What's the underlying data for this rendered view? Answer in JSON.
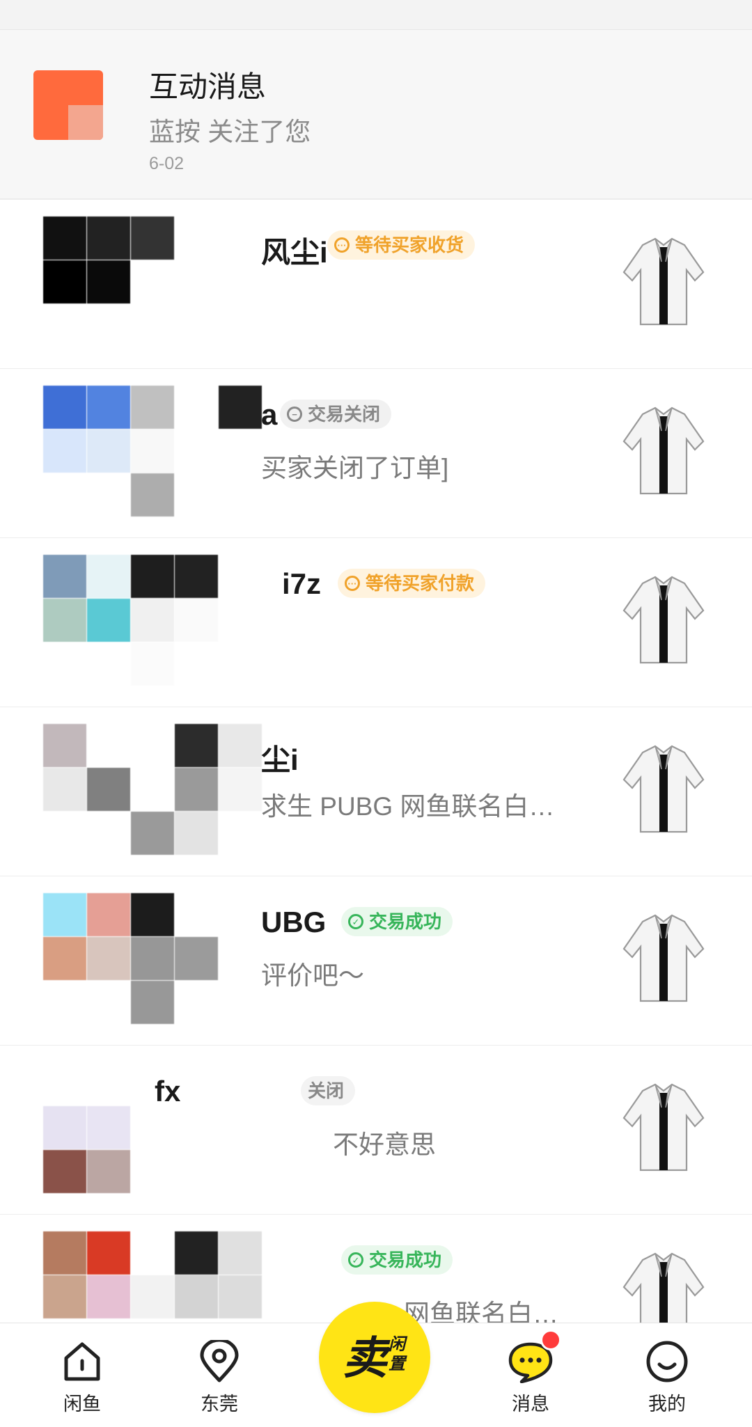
{
  "interaction": {
    "title": "互动消息",
    "message": "蓝按 关注了您",
    "time": "6-02"
  },
  "conversations": [
    {
      "name": "风尘i",
      "status": "等待买家收货",
      "status_type": "wait",
      "message": ""
    },
    {
      "name": "a",
      "status": "交易关闭",
      "status_type": "closed",
      "message": "买家关闭了订单]"
    },
    {
      "name": "i7z",
      "status": "等待买家付款",
      "status_type": "wait",
      "message": ""
    },
    {
      "name": "尘i",
      "status": "",
      "status_type": "",
      "message": "求生 PUBG 网鱼联名白…"
    },
    {
      "name": "UBG",
      "status": "交易成功",
      "status_type": "success",
      "message": "评价吧～"
    },
    {
      "name": "fx",
      "status": "关闭",
      "status_type": "closed",
      "message": "不好意思"
    },
    {
      "name": "",
      "status": "交易成功",
      "status_type": "success",
      "message": "网鱼联名白…"
    }
  ],
  "tabbar": {
    "home": "闲鱼",
    "nearby": "东莞",
    "sell_big": "卖",
    "sell_small": "闲置",
    "messages": "消息",
    "mine": "我的"
  },
  "colors": {
    "accent": "#ffe415",
    "wait": "#f0a22a",
    "success": "#37b55a",
    "notification": "#ff3b3b"
  },
  "icons": [
    "home-icon",
    "location-pin-icon",
    "chat-bubble-icon",
    "smiley-face-icon",
    "jacket-thumbnail"
  ]
}
